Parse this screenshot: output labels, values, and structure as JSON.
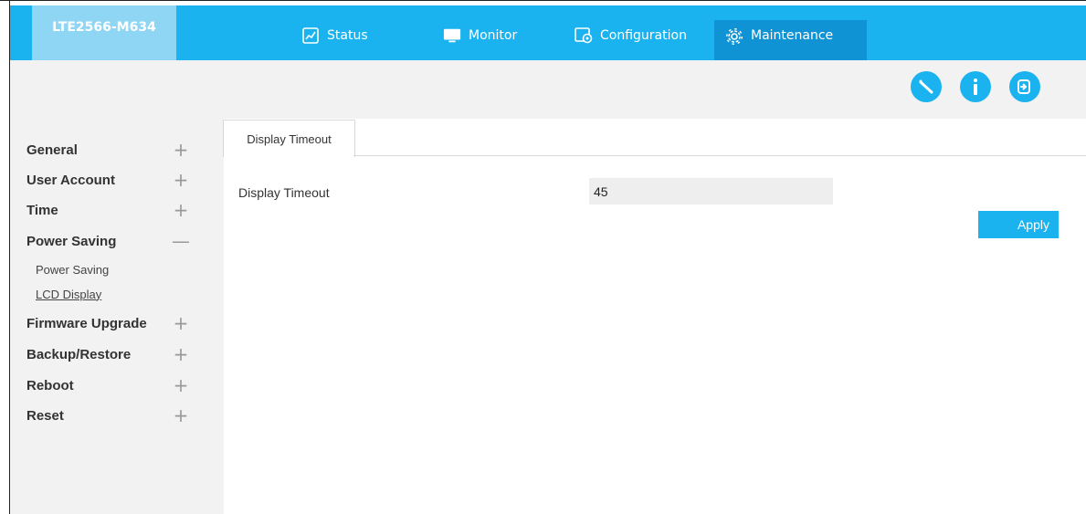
{
  "brand": "LTE2566-M634",
  "nav": {
    "status": "Status",
    "monitor": "Monitor",
    "configuration": "Configuration",
    "maintenance": "Maintenance"
  },
  "toolbar_icons": [
    "wizard-icon",
    "info-icon",
    "logout-icon"
  ],
  "sidebar": {
    "items": [
      {
        "label": "General",
        "toggle": "+"
      },
      {
        "label": "User Account",
        "toggle": "+"
      },
      {
        "label": "Time",
        "toggle": "+"
      },
      {
        "label": "Power Saving",
        "toggle": "—"
      },
      {
        "label": "Firmware Upgrade",
        "toggle": "+"
      },
      {
        "label": "Backup/Restore",
        "toggle": "+"
      },
      {
        "label": "Reboot",
        "toggle": "+"
      },
      {
        "label": "Reset",
        "toggle": "+"
      }
    ],
    "subitems": [
      "Power Saving",
      "LCD Display"
    ]
  },
  "content": {
    "tab": "Display Timeout",
    "field_label": "Display Timeout",
    "field_value": "45",
    "apply": "Apply"
  },
  "colors": {
    "accent": "#1ab3ef",
    "accent_dark": "#0f93d4",
    "brand_bg": "#8fd6f4",
    "panel_bg": "#f2f2f2"
  }
}
